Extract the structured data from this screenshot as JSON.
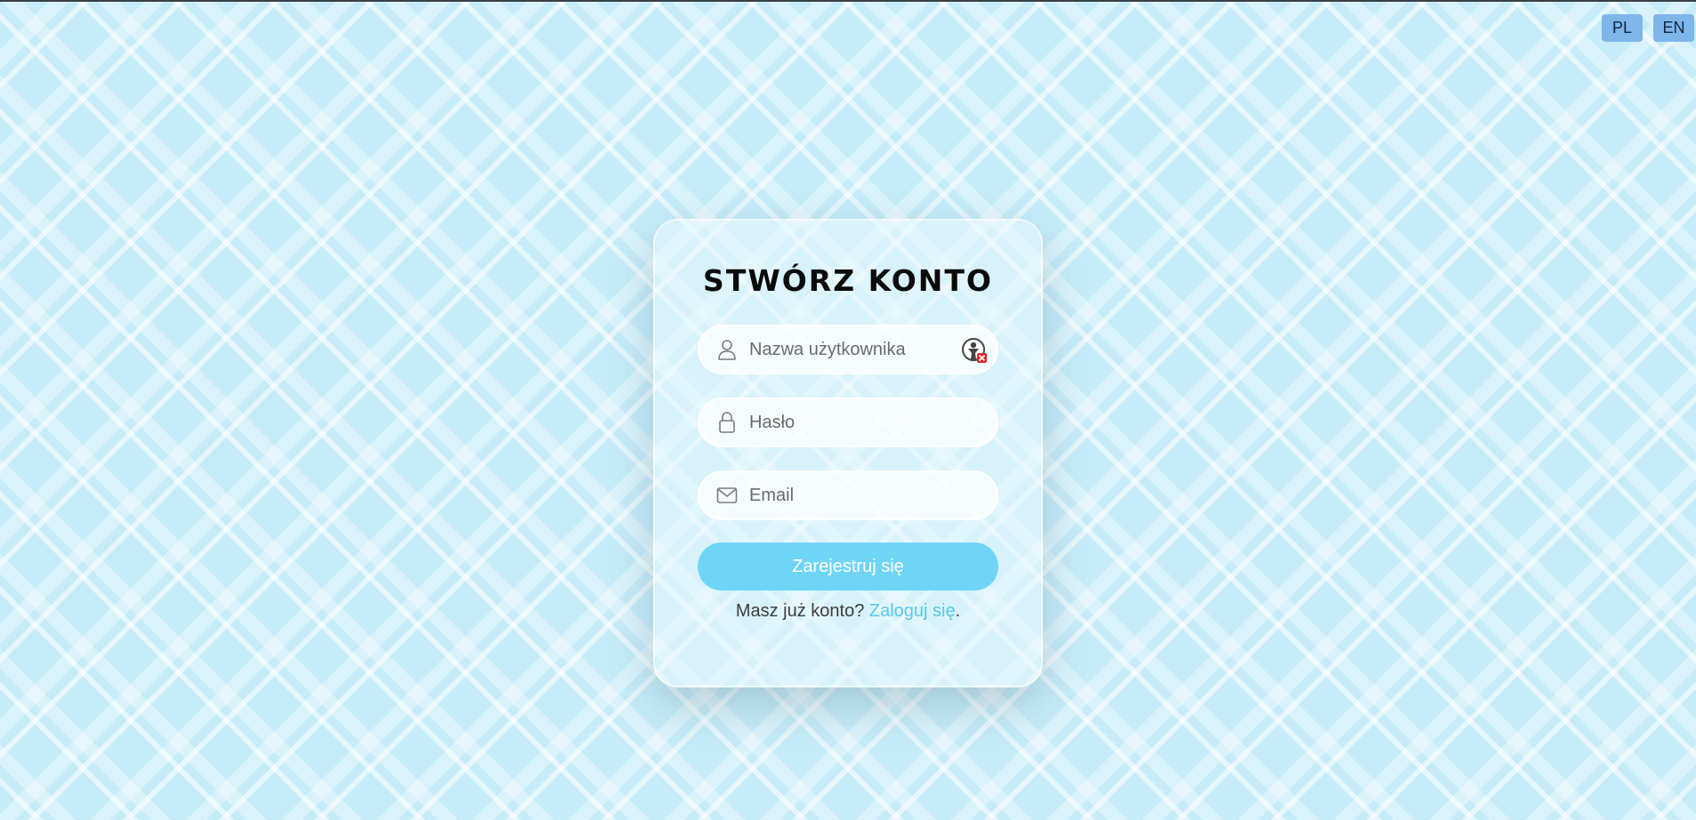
{
  "language_switcher": {
    "options": [
      "PL",
      "EN"
    ]
  },
  "register_form": {
    "title": "STWÓRZ KONTO",
    "username_placeholder": "Nazwa użytkownika",
    "password_placeholder": "Hasło",
    "email_placeholder": "Email",
    "submit_label": "Zarejestruj się",
    "login_prompt": "Masz już konto?",
    "login_link": "Zaloguj się",
    "login_suffix": "."
  },
  "icons": {
    "username": "user-icon",
    "password": "lock-icon",
    "email": "envelope-icon",
    "extension": "password-manager-badge-icon"
  },
  "colors": {
    "background": "#c6ecf9",
    "submit_button": "#6fd5f6",
    "link": "#54c9ee",
    "lang_button": "#7eb6ec"
  }
}
